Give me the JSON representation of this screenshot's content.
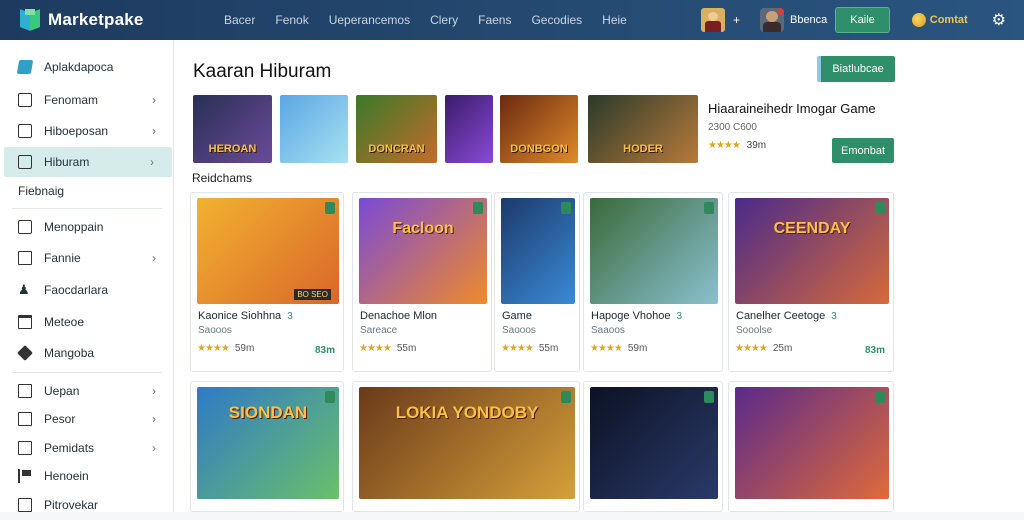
{
  "header": {
    "logo_text": "Marketpake",
    "nav": [
      "Bacer",
      "Fenok",
      "Ueperancemos",
      "Clery",
      "Faens",
      "Gecodies",
      "Heie"
    ],
    "user_name": "Bbenca",
    "action_button": "Kaile",
    "coins_label": "Comtat",
    "arrow_label": "+"
  },
  "sidebar": {
    "items": [
      {
        "label": "Aplakdapoca",
        "chevron": false,
        "icon": "folder-icon"
      },
      {
        "label": "Fenomam",
        "chevron": true,
        "icon": "square-icon"
      },
      {
        "label": "Hiboeposan",
        "chevron": true,
        "icon": "box-icon"
      },
      {
        "label": "Hiburam",
        "chevron": true,
        "icon": "grid-icon"
      },
      {
        "label": "Fiebnaig",
        "chevron": false,
        "icon": ""
      },
      {
        "label": "Menoppain",
        "chevron": false,
        "icon": "list-icon"
      },
      {
        "label": "Fannie",
        "chevron": true,
        "icon": "bookmark-icon"
      },
      {
        "label": "Faocdarlara",
        "chevron": false,
        "icon": "user-icon"
      },
      {
        "label": "Meteoe",
        "chevron": false,
        "icon": "window-icon"
      },
      {
        "label": "Mangoba",
        "chevron": false,
        "icon": "cube-icon"
      },
      {
        "label": "Uepan",
        "chevron": true,
        "icon": "document-icon"
      },
      {
        "label": "Pesor",
        "chevron": true,
        "icon": "folder-icon"
      },
      {
        "label": "Pemidats",
        "chevron": true,
        "icon": "box-icon"
      },
      {
        "label": "Henoein",
        "chevron": false,
        "icon": "flag-icon"
      },
      {
        "label": "Pitrovekar",
        "chevron": false,
        "icon": "doc-icon"
      }
    ]
  },
  "main": {
    "title": "Kaaran Hiburam",
    "top_button": "Biatlubcae",
    "featured": {
      "title": "Hiaaraineihedr Imogar Game",
      "sub": "2300 C600",
      "rating": "39m",
      "buy_label": "Emonbat"
    },
    "section_label": "Reidchams",
    "thumbs": [
      {
        "label": "HEROAN",
        "colors": [
          "#2a2f55",
          "#6a4b9a"
        ]
      },
      {
        "label": "",
        "colors": [
          "#5aa6e6",
          "#a8e2f0"
        ]
      },
      {
        "label": "DONCRAN",
        "colors": [
          "#3a7a2a",
          "#c46b2a"
        ]
      },
      {
        "label": "",
        "colors": [
          "#3a1c6b",
          "#8a4ad6"
        ]
      },
      {
        "label": "DONBGON",
        "colors": [
          "#6b2a10",
          "#e08a2a"
        ]
      },
      {
        "label": "HODER",
        "colors": [
          "#2a3a2a",
          "#b87a3a"
        ]
      }
    ],
    "cards": [
      {
        "title": "Kaonice Siohhna",
        "tag": "3",
        "sub": "Saooos",
        "rating": "59m",
        "price": "83m",
        "img_label": "",
        "colors": [
          "#f2b230",
          "#d9672a"
        ],
        "badge": "BO SEO"
      },
      {
        "title": "Denachoe Mlon",
        "tag": "",
        "sub": "Sareace",
        "rating": "55m",
        "price": "",
        "img_label": "Facloon",
        "colors": [
          "#7a4ad6",
          "#f08a2a"
        ],
        "badge": ""
      },
      {
        "title": "Game",
        "tag": "",
        "sub": "Saooos",
        "rating": "55m",
        "price": "",
        "img_label": "",
        "colors": [
          "#1c3a6b",
          "#3a8ad6"
        ],
        "badge": ""
      },
      {
        "title": "Hapoge Vhohoe",
        "tag": "3",
        "sub": "Saaoos",
        "rating": "59m",
        "price": "",
        "img_label": "",
        "colors": [
          "#3a6a3a",
          "#8ac0d0"
        ],
        "badge": ""
      },
      {
        "title": "Canelher Ceetoge",
        "tag": "3",
        "sub": "Sooolse",
        "rating": "25m",
        "price": "83m",
        "img_label": "CEENDAY",
        "colors": [
          "#4a2a8a",
          "#d66a3a"
        ],
        "badge": ""
      }
    ],
    "cards_row2": [
      {
        "img_label": "SIONDAN",
        "colors": [
          "#2f7ac6",
          "#6ac06a"
        ]
      },
      {
        "img_label": "LOKIA YONDOBY",
        "colors": [
          "#6a3a1a",
          "#d6a03a"
        ]
      },
      {
        "img_label": "",
        "colors": [
          "#0c1224",
          "#2a3a6a"
        ]
      },
      {
        "img_label": "",
        "colors": [
          "#5a2a8a",
          "#e06a3a"
        ]
      }
    ]
  }
}
